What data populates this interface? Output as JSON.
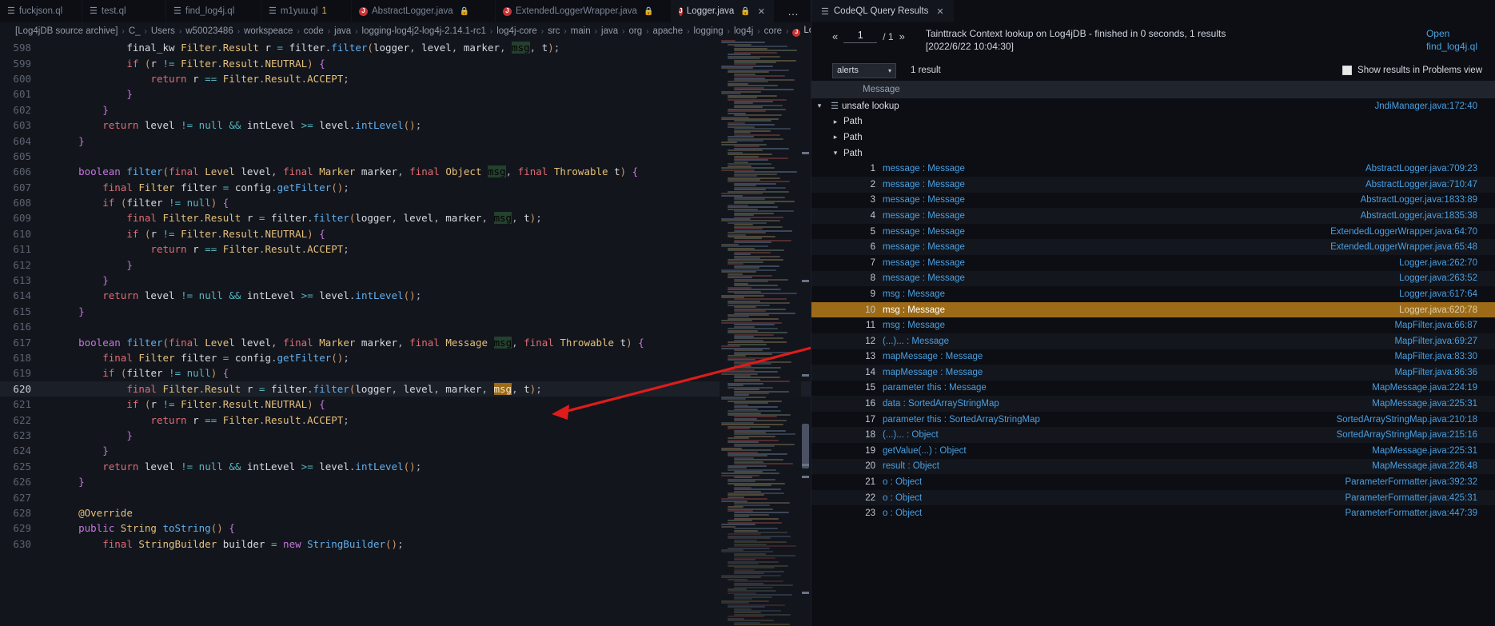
{
  "editor": {
    "tabs": [
      {
        "label": "fuckjson.ql",
        "icon": "ql-icon",
        "active": false,
        "modified": false,
        "locked": false,
        "closable": false
      },
      {
        "label": "test.ql",
        "icon": "ql-icon",
        "active": false,
        "modified": false,
        "locked": false,
        "closable": false
      },
      {
        "label": "find_log4j.ql",
        "icon": "ql-icon",
        "active": false,
        "modified": false,
        "locked": false,
        "closable": false
      },
      {
        "label": "m1yuu.ql",
        "icon": "ql-icon",
        "active": false,
        "modified": true,
        "badge": "1",
        "locked": false,
        "closable": false
      },
      {
        "label": "AbstractLogger.java",
        "icon": "java-icon",
        "active": false,
        "modified": false,
        "locked": true,
        "closable": false
      },
      {
        "label": "ExtendedLoggerWrapper.java",
        "icon": "java-icon",
        "active": false,
        "modified": false,
        "locked": true,
        "closable": false
      },
      {
        "label": "Logger.java",
        "icon": "java-icon",
        "active": true,
        "modified": false,
        "locked": true,
        "closable": true
      }
    ],
    "more_actions": "…",
    "breadcrumb": [
      "[Log4jDB source archive]",
      "C_",
      "Users",
      "w50023486",
      "workspeace",
      "code",
      "java",
      "logging-log4j2-log4j-2.14.1-rc1",
      "log4j-core",
      "src",
      "main",
      "java",
      "org",
      "apache",
      "logging",
      "log4j",
      "core",
      "Logger.java"
    ],
    "breadcrumb_last_icon": "java-icon",
    "current_line": 620,
    "highlight_token": "msg",
    "lines": [
      {
        "n": 598,
        "indent": 6,
        "html": "final_kw Filter.Result r = filter.filter(logger, level, marker, msg, t);"
      },
      {
        "n": 599,
        "indent": 6,
        "html": "if (r != Filter.Result.NEUTRAL) {"
      },
      {
        "n": 600,
        "indent": 8,
        "html": "return r == Filter.Result.ACCEPT;"
      },
      {
        "n": 601,
        "indent": 6,
        "html": "}"
      },
      {
        "n": 602,
        "indent": 4,
        "html": "}"
      },
      {
        "n": 603,
        "indent": 4,
        "html": "return level != null && intLevel >= level.intLevel();"
      },
      {
        "n": 604,
        "indent": 2,
        "html": "}"
      },
      {
        "n": 605,
        "indent": 0,
        "html": ""
      },
      {
        "n": 606,
        "indent": 2,
        "html": "boolean filter(final Level level, final Marker marker, final Object msg, final Throwable t) {"
      },
      {
        "n": 607,
        "indent": 4,
        "html": "final Filter filter = config.getFilter();"
      },
      {
        "n": 608,
        "indent": 4,
        "html": "if (filter != null) {"
      },
      {
        "n": 609,
        "indent": 6,
        "html": "final Filter.Result r = filter.filter(logger, level, marker, msg, t);"
      },
      {
        "n": 610,
        "indent": 6,
        "html": "if (r != Filter.Result.NEUTRAL) {"
      },
      {
        "n": 611,
        "indent": 8,
        "html": "return r == Filter.Result.ACCEPT;"
      },
      {
        "n": 612,
        "indent": 6,
        "html": "}"
      },
      {
        "n": 613,
        "indent": 4,
        "html": "}"
      },
      {
        "n": 614,
        "indent": 4,
        "html": "return level != null && intLevel >= level.intLevel();"
      },
      {
        "n": 615,
        "indent": 2,
        "html": "}"
      },
      {
        "n": 616,
        "indent": 0,
        "html": ""
      },
      {
        "n": 617,
        "indent": 2,
        "html": "boolean filter(final Level level, final Marker marker, final Message msg, final Throwable t) {"
      },
      {
        "n": 618,
        "indent": 4,
        "html": "final Filter filter = config.getFilter();"
      },
      {
        "n": 619,
        "indent": 4,
        "html": "if (filter != null) {"
      },
      {
        "n": 620,
        "indent": 6,
        "html": "final Filter.Result r = filter.filter(logger, level, marker, msg, t);"
      },
      {
        "n": 621,
        "indent": 6,
        "html": "if (r != Filter.Result.NEUTRAL) {"
      },
      {
        "n": 622,
        "indent": 8,
        "html": "return r == Filter.Result.ACCEPT;"
      },
      {
        "n": 623,
        "indent": 6,
        "html": "}"
      },
      {
        "n": 624,
        "indent": 4,
        "html": "}"
      },
      {
        "n": 625,
        "indent": 4,
        "html": "return level != null && intLevel >= level.intLevel();"
      },
      {
        "n": 626,
        "indent": 2,
        "html": "}"
      },
      {
        "n": 627,
        "indent": 0,
        "html": ""
      },
      {
        "n": 628,
        "indent": 2,
        "html": "@Override"
      },
      {
        "n": 629,
        "indent": 2,
        "html": "public String toString() {"
      },
      {
        "n": 630,
        "indent": 4,
        "html": "final StringBuilder builder = new StringBuilder();"
      }
    ]
  },
  "results": {
    "tab": {
      "label": "CodeQL Query Results",
      "icon": "list-icon",
      "close": "✕"
    },
    "pager": {
      "prev": "«",
      "next": "»",
      "current": "1",
      "total": "/ 1"
    },
    "status": "Tainttrack Context lookup on Log4jDB - finished in 0 seconds, 1 results [2022/6/22 10:04:30]",
    "open_label": "Open",
    "open_file": "find_log4j.ql",
    "filter": {
      "selected": "alerts",
      "caret": "⌄",
      "count": "1 result"
    },
    "problems_toggle_label": "Show results in Problems view",
    "problems_toggle_checked": true,
    "column_header": "Message",
    "alert": {
      "label": "unsafe lookup",
      "location": "JndiManager.java:172:40",
      "expanded": true
    },
    "paths": [
      {
        "label": "Path",
        "expanded": false
      },
      {
        "label": "Path",
        "expanded": false
      },
      {
        "label": "Path",
        "expanded": true
      }
    ],
    "selected_step": 10,
    "steps": [
      {
        "i": 1,
        "label": "message : Message",
        "loc": "AbstractLogger.java:709:23"
      },
      {
        "i": 2,
        "label": "message : Message",
        "loc": "AbstractLogger.java:710:47"
      },
      {
        "i": 3,
        "label": "message : Message",
        "loc": "AbstractLogger.java:1833:89"
      },
      {
        "i": 4,
        "label": "message : Message",
        "loc": "AbstractLogger.java:1835:38"
      },
      {
        "i": 5,
        "label": "message : Message",
        "loc": "ExtendedLoggerWrapper.java:64:70"
      },
      {
        "i": 6,
        "label": "message : Message",
        "loc": "ExtendedLoggerWrapper.java:65:48"
      },
      {
        "i": 7,
        "label": "message : Message",
        "loc": "Logger.java:262:70"
      },
      {
        "i": 8,
        "label": "message : Message",
        "loc": "Logger.java:263:52"
      },
      {
        "i": 9,
        "label": "msg : Message",
        "loc": "Logger.java:617:64"
      },
      {
        "i": 10,
        "label": "msg : Message",
        "loc": "Logger.java:620:78"
      },
      {
        "i": 11,
        "label": "msg : Message",
        "loc": "MapFilter.java:66:87"
      },
      {
        "i": 12,
        "label": "(...)... : Message",
        "loc": "MapFilter.java:69:27"
      },
      {
        "i": 13,
        "label": "mapMessage : Message",
        "loc": "MapFilter.java:83:30"
      },
      {
        "i": 14,
        "label": "mapMessage : Message",
        "loc": "MapFilter.java:86:36"
      },
      {
        "i": 15,
        "label": "parameter this : Message",
        "loc": "MapMessage.java:224:19"
      },
      {
        "i": 16,
        "label": "data : SortedArrayStringMap",
        "loc": "MapMessage.java:225:31"
      },
      {
        "i": 17,
        "label": "parameter this : SortedArrayStringMap",
        "loc": "SortedArrayStringMap.java:210:18"
      },
      {
        "i": 18,
        "label": "(...)... : Object",
        "loc": "SortedArrayStringMap.java:215:16"
      },
      {
        "i": 19,
        "label": "getValue(...) : Object",
        "loc": "MapMessage.java:225:31"
      },
      {
        "i": 20,
        "label": "result : Object",
        "loc": "MapMessage.java:226:48"
      },
      {
        "i": 21,
        "label": "o : Object",
        "loc": "ParameterFormatter.java:392:32"
      },
      {
        "i": 22,
        "label": "o : Object",
        "loc": "ParameterFormatter.java:425:31"
      },
      {
        "i": 23,
        "label": "o : Object",
        "loc": "ParameterFormatter.java:447:39"
      }
    ]
  },
  "colors": {
    "accent_blue": "#4a9fe0",
    "selection_gold": "#9d6b17",
    "editor_bg": "#12151c",
    "panel_bg": "#0c0e14",
    "arrow_red": "#e01b1b",
    "modified_tab": "#d7b150"
  }
}
